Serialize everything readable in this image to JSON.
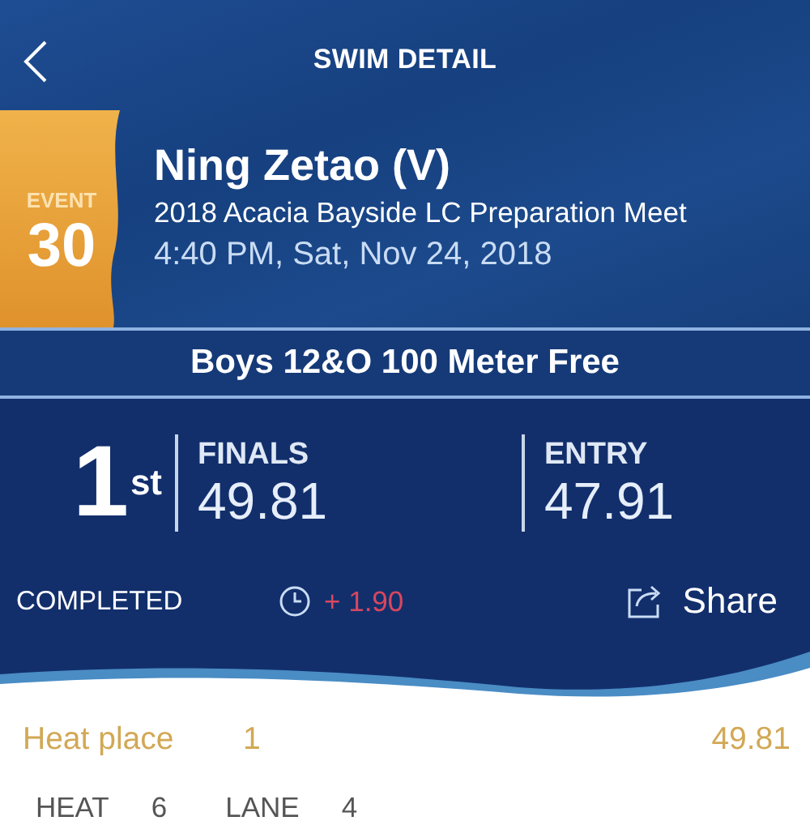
{
  "title": "SWIM DETAIL",
  "event": {
    "label": "EVENT",
    "number": "30"
  },
  "swimmer": {
    "name": "Ning Zetao (V)",
    "meet": "2018 Acacia Bayside LC Preparation Meet",
    "datetime": "4:40 PM, Sat, Nov 24, 2018"
  },
  "race": "Boys 12&O 100 Meter Free",
  "place": {
    "number": "1",
    "suffix": "st"
  },
  "times": [
    {
      "label": "FINALS",
      "value": "49.81"
    },
    {
      "label": "ENTRY",
      "value": "47.91"
    }
  ],
  "status": "COMPLETED",
  "difference": "+ 1.90",
  "share": "Share",
  "heat_place": {
    "label": "Heat place",
    "value": "1",
    "time": "49.81"
  },
  "details": [
    {
      "label": "HEAT",
      "value": "6"
    },
    {
      "label": "LANE",
      "value": "4"
    }
  ]
}
